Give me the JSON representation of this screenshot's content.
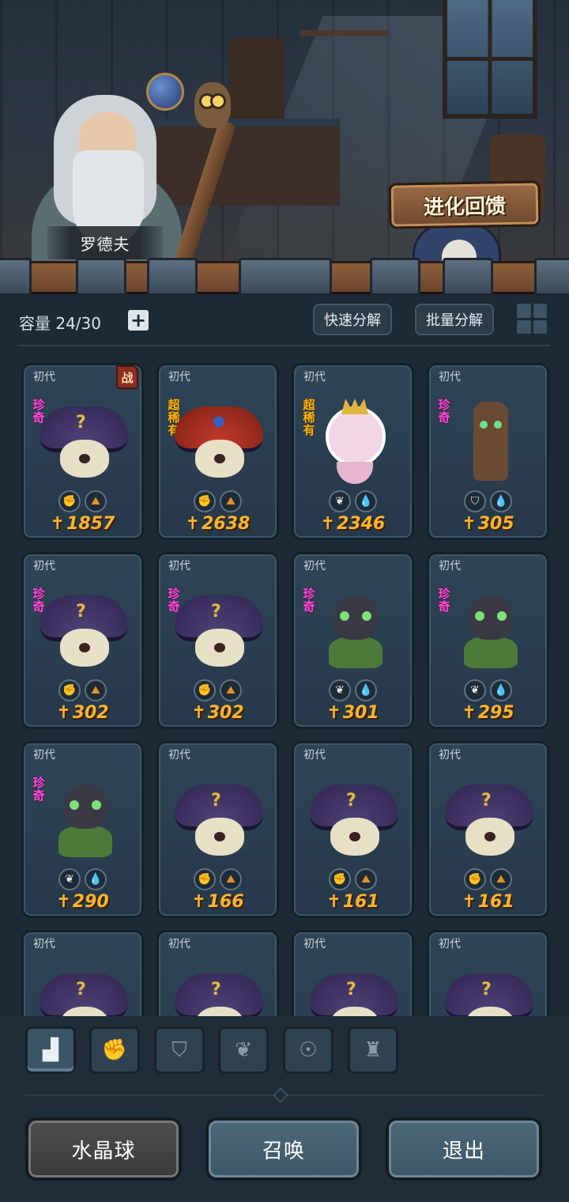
{
  "scene": {
    "npc_name": "罗德夫",
    "evolution_button": "进化回馈"
  },
  "inventory": {
    "capacity_label": "容量 24/30",
    "add_icon": "plus-icon",
    "quick_decompose": "快速分解",
    "batch_decompose": "批量分解",
    "view_toggle_icon": "grid-view-icon"
  },
  "cards": [
    {
      "gen": "初代",
      "rarity": "珍奇",
      "rarity_type": "rare",
      "battle": "战",
      "monster": "shroom",
      "types": [
        "fist",
        "earth"
      ],
      "power": "1857"
    },
    {
      "gen": "初代",
      "rarity": "超稀有",
      "rarity_type": "super",
      "battle": "",
      "monster": "owl",
      "types": [
        "fist",
        "earth"
      ],
      "power": "2638"
    },
    {
      "gen": "初代",
      "rarity": "超稀有",
      "rarity_type": "super",
      "battle": "",
      "monster": "angel",
      "types": [
        "plant",
        "water"
      ],
      "power": "2346"
    },
    {
      "gen": "初代",
      "rarity": "珍奇",
      "rarity_type": "rare",
      "battle": "",
      "monster": "tree",
      "types": [
        "shield",
        "water"
      ],
      "power": "305"
    },
    {
      "gen": "初代",
      "rarity": "珍奇",
      "rarity_type": "rare",
      "battle": "",
      "monster": "shroom",
      "types": [
        "fist",
        "earth"
      ],
      "power": "302"
    },
    {
      "gen": "初代",
      "rarity": "珍奇",
      "rarity_type": "rare",
      "battle": "",
      "monster": "shroom",
      "types": [
        "fist",
        "earth"
      ],
      "power": "302"
    },
    {
      "gen": "初代",
      "rarity": "珍奇",
      "rarity_type": "rare",
      "battle": "",
      "monster": "dragon",
      "types": [
        "plant",
        "water"
      ],
      "power": "301"
    },
    {
      "gen": "初代",
      "rarity": "珍奇",
      "rarity_type": "rare",
      "battle": "",
      "monster": "dragon",
      "types": [
        "plant",
        "water"
      ],
      "power": "295"
    },
    {
      "gen": "初代",
      "rarity": "珍奇",
      "rarity_type": "rare",
      "battle": "",
      "monster": "dragon",
      "types": [
        "plant",
        "water"
      ],
      "power": "290"
    },
    {
      "gen": "初代",
      "rarity": "",
      "rarity_type": "",
      "battle": "",
      "monster": "shroom",
      "types": [
        "fist",
        "earth"
      ],
      "power": "166"
    },
    {
      "gen": "初代",
      "rarity": "",
      "rarity_type": "",
      "battle": "",
      "monster": "shroom",
      "types": [
        "fist",
        "earth"
      ],
      "power": "161"
    },
    {
      "gen": "初代",
      "rarity": "",
      "rarity_type": "",
      "battle": "",
      "monster": "shroom",
      "types": [
        "fist",
        "earth"
      ],
      "power": "161"
    },
    {
      "gen": "初代",
      "rarity": "",
      "rarity_type": "",
      "battle": "",
      "monster": "shroom",
      "types": [],
      "power": ""
    },
    {
      "gen": "初代",
      "rarity": "",
      "rarity_type": "",
      "battle": "",
      "monster": "shroom",
      "types": [],
      "power": ""
    },
    {
      "gen": "初代",
      "rarity": "",
      "rarity_type": "",
      "battle": "",
      "monster": "shroom",
      "types": [],
      "power": ""
    },
    {
      "gen": "初代",
      "rarity": "",
      "rarity_type": "",
      "battle": "",
      "monster": "shroom",
      "types": [],
      "power": ""
    }
  ],
  "type_icons": {
    "fist": "fist-icon",
    "earth": "earth-icon",
    "plant": "sprout-icon",
    "water": "water-drop-icon",
    "shield": "shield-icon"
  },
  "filter_tabs": [
    {
      "icon": "all-blocks-icon",
      "active": true
    },
    {
      "icon": "fist-icon",
      "active": false
    },
    {
      "icon": "shield-icon",
      "active": false
    },
    {
      "icon": "sprout-icon",
      "active": false
    },
    {
      "icon": "alien-head-icon",
      "active": false
    },
    {
      "icon": "tower-icon",
      "active": false
    }
  ],
  "actions": {
    "crystal_ball": "水晶球",
    "summon": "召唤",
    "exit": "退出"
  },
  "colors": {
    "rare": "#ff4bd8",
    "super_rare": "#ffb400",
    "power": "#ffb42c"
  }
}
